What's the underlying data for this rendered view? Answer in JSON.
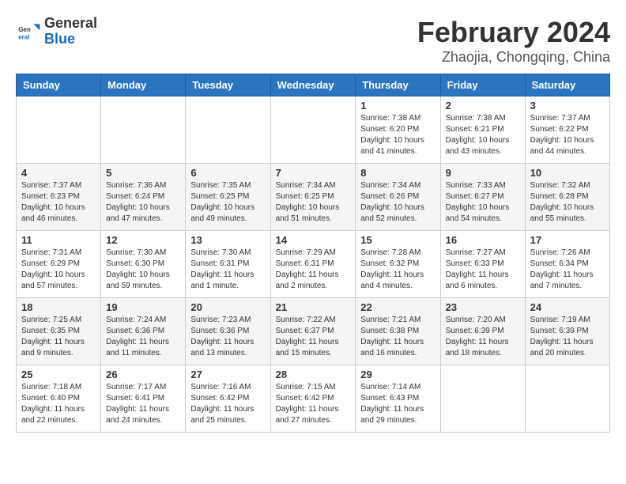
{
  "header": {
    "logo_general": "General",
    "logo_blue": "Blue",
    "main_title": "February 2024",
    "subtitle": "Zhaojia, Chongqing, China"
  },
  "days_of_week": [
    "Sunday",
    "Monday",
    "Tuesday",
    "Wednesday",
    "Thursday",
    "Friday",
    "Saturday"
  ],
  "weeks": [
    [
      {
        "day": "",
        "info": ""
      },
      {
        "day": "",
        "info": ""
      },
      {
        "day": "",
        "info": ""
      },
      {
        "day": "",
        "info": ""
      },
      {
        "day": "1",
        "info": "Sunrise: 7:38 AM\nSunset: 6:20 PM\nDaylight: 10 hours and 41 minutes."
      },
      {
        "day": "2",
        "info": "Sunrise: 7:38 AM\nSunset: 6:21 PM\nDaylight: 10 hours and 43 minutes."
      },
      {
        "day": "3",
        "info": "Sunrise: 7:37 AM\nSunset: 6:22 PM\nDaylight: 10 hours and 44 minutes."
      }
    ],
    [
      {
        "day": "4",
        "info": "Sunrise: 7:37 AM\nSunset: 6:23 PM\nDaylight: 10 hours and 46 minutes."
      },
      {
        "day": "5",
        "info": "Sunrise: 7:36 AM\nSunset: 6:24 PM\nDaylight: 10 hours and 47 minutes."
      },
      {
        "day": "6",
        "info": "Sunrise: 7:35 AM\nSunset: 6:25 PM\nDaylight: 10 hours and 49 minutes."
      },
      {
        "day": "7",
        "info": "Sunrise: 7:34 AM\nSunset: 6:25 PM\nDaylight: 10 hours and 51 minutes."
      },
      {
        "day": "8",
        "info": "Sunrise: 7:34 AM\nSunset: 6:26 PM\nDaylight: 10 hours and 52 minutes."
      },
      {
        "day": "9",
        "info": "Sunrise: 7:33 AM\nSunset: 6:27 PM\nDaylight: 10 hours and 54 minutes."
      },
      {
        "day": "10",
        "info": "Sunrise: 7:32 AM\nSunset: 6:28 PM\nDaylight: 10 hours and 55 minutes."
      }
    ],
    [
      {
        "day": "11",
        "info": "Sunrise: 7:31 AM\nSunset: 6:29 PM\nDaylight: 10 hours and 57 minutes."
      },
      {
        "day": "12",
        "info": "Sunrise: 7:30 AM\nSunset: 6:30 PM\nDaylight: 10 hours and 59 minutes."
      },
      {
        "day": "13",
        "info": "Sunrise: 7:30 AM\nSunset: 6:31 PM\nDaylight: 11 hours and 1 minute."
      },
      {
        "day": "14",
        "info": "Sunrise: 7:29 AM\nSunset: 6:31 PM\nDaylight: 11 hours and 2 minutes."
      },
      {
        "day": "15",
        "info": "Sunrise: 7:28 AM\nSunset: 6:32 PM\nDaylight: 11 hours and 4 minutes."
      },
      {
        "day": "16",
        "info": "Sunrise: 7:27 AM\nSunset: 6:33 PM\nDaylight: 11 hours and 6 minutes."
      },
      {
        "day": "17",
        "info": "Sunrise: 7:26 AM\nSunset: 6:34 PM\nDaylight: 11 hours and 7 minutes."
      }
    ],
    [
      {
        "day": "18",
        "info": "Sunrise: 7:25 AM\nSunset: 6:35 PM\nDaylight: 11 hours and 9 minutes."
      },
      {
        "day": "19",
        "info": "Sunrise: 7:24 AM\nSunset: 6:36 PM\nDaylight: 11 hours and 11 minutes."
      },
      {
        "day": "20",
        "info": "Sunrise: 7:23 AM\nSunset: 6:36 PM\nDaylight: 11 hours and 13 minutes."
      },
      {
        "day": "21",
        "info": "Sunrise: 7:22 AM\nSunset: 6:37 PM\nDaylight: 11 hours and 15 minutes."
      },
      {
        "day": "22",
        "info": "Sunrise: 7:21 AM\nSunset: 6:38 PM\nDaylight: 11 hours and 16 minutes."
      },
      {
        "day": "23",
        "info": "Sunrise: 7:20 AM\nSunset: 6:39 PM\nDaylight: 11 hours and 18 minutes."
      },
      {
        "day": "24",
        "info": "Sunrise: 7:19 AM\nSunset: 6:39 PM\nDaylight: 11 hours and 20 minutes."
      }
    ],
    [
      {
        "day": "25",
        "info": "Sunrise: 7:18 AM\nSunset: 6:40 PM\nDaylight: 11 hours and 22 minutes."
      },
      {
        "day": "26",
        "info": "Sunrise: 7:17 AM\nSunset: 6:41 PM\nDaylight: 11 hours and 24 minutes."
      },
      {
        "day": "27",
        "info": "Sunrise: 7:16 AM\nSunset: 6:42 PM\nDaylight: 11 hours and 25 minutes."
      },
      {
        "day": "28",
        "info": "Sunrise: 7:15 AM\nSunset: 6:42 PM\nDaylight: 11 hours and 27 minutes."
      },
      {
        "day": "29",
        "info": "Sunrise: 7:14 AM\nSunset: 6:43 PM\nDaylight: 11 hours and 29 minutes."
      },
      {
        "day": "",
        "info": ""
      },
      {
        "day": "",
        "info": ""
      }
    ]
  ]
}
